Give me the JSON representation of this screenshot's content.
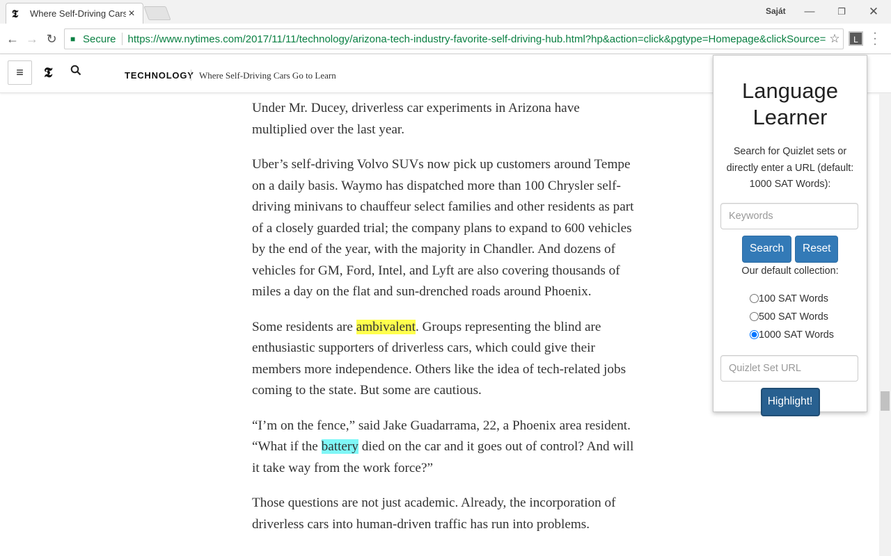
{
  "browser": {
    "tab_title": "Where Self-Driving Cars Go to Learn",
    "tab_favicon": "𝕿",
    "close_glyph": "×",
    "profile_name": "Saját",
    "secure_label": "Secure",
    "url": "https://www.nytimes.com/2017/11/11/technology/arizona-tech-industry-favorite-self-driving-hub.html?hp&action=click&pgtype=Homepage&clickSource=stor...",
    "extension_label": "L",
    "icons": {
      "back": "back-arrow-icon",
      "forward": "forward-arrow-icon",
      "reload": "reload-icon",
      "lock": "lock-icon",
      "bookmark": "star-icon",
      "menu": "kebab-menu-icon"
    }
  },
  "site_header": {
    "logo": "𝕿",
    "section": "TECHNOLOGY",
    "title": "Where Self-Driving Cars Go to Learn",
    "icons": [
      "hamburger-menu-icon",
      "nyt-logo-icon",
      "search-icon"
    ]
  },
  "article": {
    "p1": "Under Mr. Ducey, driverless car experiments in Arizona have multiplied over the last year.",
    "p2": "Uber’s self-driving Volvo SUVs now pick up customers around Tempe on a daily basis. Waymo has dispatched more than 100 Chrysler self-driving minivans to chauffeur select families and other residents as part of a closely guarded trial; the company plans to expand to 600 vehicles by the end of the year, with the majority in Chandler. And dozens of vehicles for GM, Ford, Intel, and Lyft are also covering thousands of miles a day on the flat and sun-drenched roads around Phoenix.",
    "p3_before": "Some residents are ",
    "p3_highlight": "ambivalent",
    "p3_after": ". Groups representing the blind are enthusiastic supporters of driverless cars, which could give their members more independence. Others like the idea of tech-related jobs coming to the state. But some are cautious.",
    "p4_before": "“I’m on the fence,” said Jake Guadarrama, 22, a Phoenix area resident. “What if the ",
    "p4_highlight": "battery",
    "p4_after": " died on the car and it goes out of control? And will it take way from the work force?”",
    "p5": "Those questions are not just academic. Already, the incorporation of driverless cars into human-driven traffic has run into problems.",
    "highlight_colors": {
      "yellow": "#ffff4d",
      "cyan": "#7ff7f7"
    }
  },
  "popup": {
    "title": "Language Learner",
    "description": "Search for Quizlet sets or directly enter a URL (default: 1000 SAT Words):",
    "keywords_placeholder": "Keywords",
    "search_label": "Search",
    "reset_label": "Reset",
    "collection_label": "Our default collection:",
    "options": [
      "100 SAT Words",
      "500 SAT Words",
      "1000 SAT Words"
    ],
    "selected_option": "1000 SAT Words",
    "url_placeholder": "Quizlet Set URL",
    "highlight_label": "Highlight!",
    "button_color": "#337ab7"
  }
}
